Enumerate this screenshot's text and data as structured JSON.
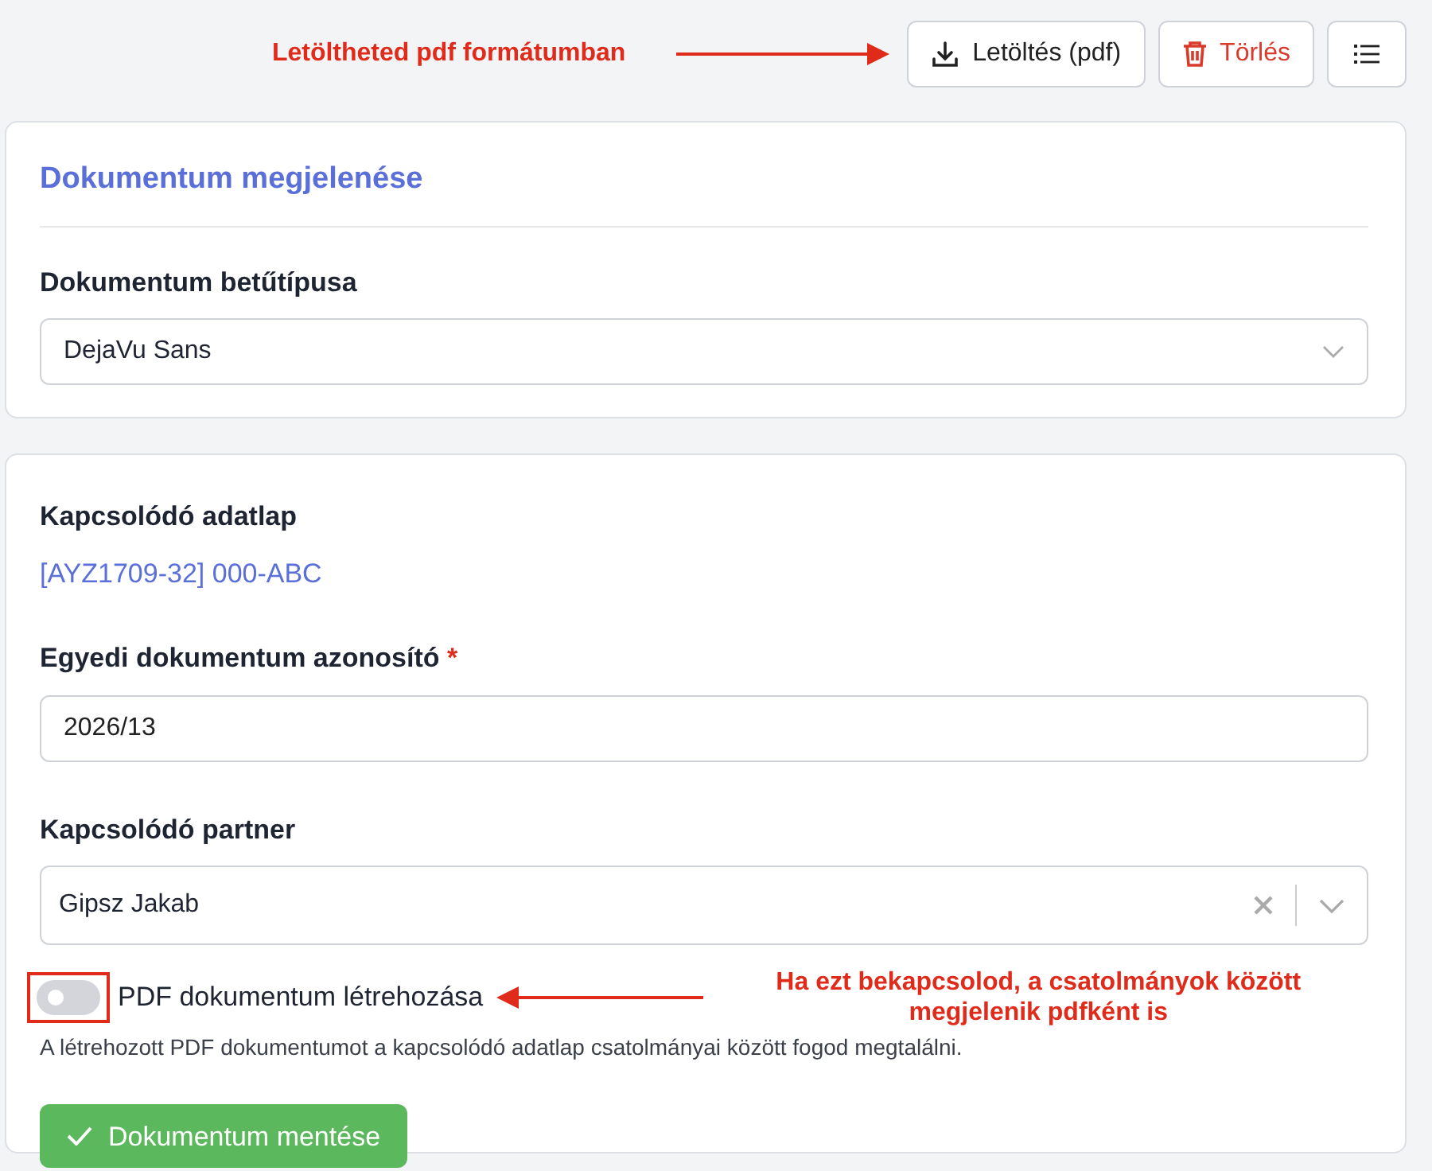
{
  "toolbar": {
    "annotation": "Letöltheted pdf formátumban",
    "buttons": [
      {
        "kind": "download",
        "label": "Letöltés (pdf)"
      },
      {
        "kind": "delete",
        "label": "Törlés"
      },
      {
        "kind": "menu"
      }
    ]
  },
  "appearance_card": {
    "title": "Dokumentum megjelenése",
    "font_field": {
      "label": "Dokumentum betűtípusa",
      "value": "DejaVu Sans"
    }
  },
  "record_card": {
    "related_sheet": {
      "label": "Kapcsolódó adatlap",
      "link": "[AYZ1709-32] 000-ABC"
    },
    "document_id": {
      "label": "Egyedi dokumentum azonosító",
      "required_mark": "*",
      "value": "2026/13"
    },
    "partner": {
      "label": "Kapcsolódó partner",
      "value": "Gipsz Jakab"
    },
    "pdf_switch": {
      "label": "PDF dokumentum létrehozása",
      "on": false,
      "highlighted": true,
      "annotation": "Ha ezt bekapcsolod, a csatolmányok között megjelenik pdfként is",
      "hint": "A létrehozott PDF dokumentumot a kapcsolódó adatlap csatolmányai között fogod megtalálni."
    },
    "save_button": {
      "label": "Dokumentum mentése"
    }
  }
}
